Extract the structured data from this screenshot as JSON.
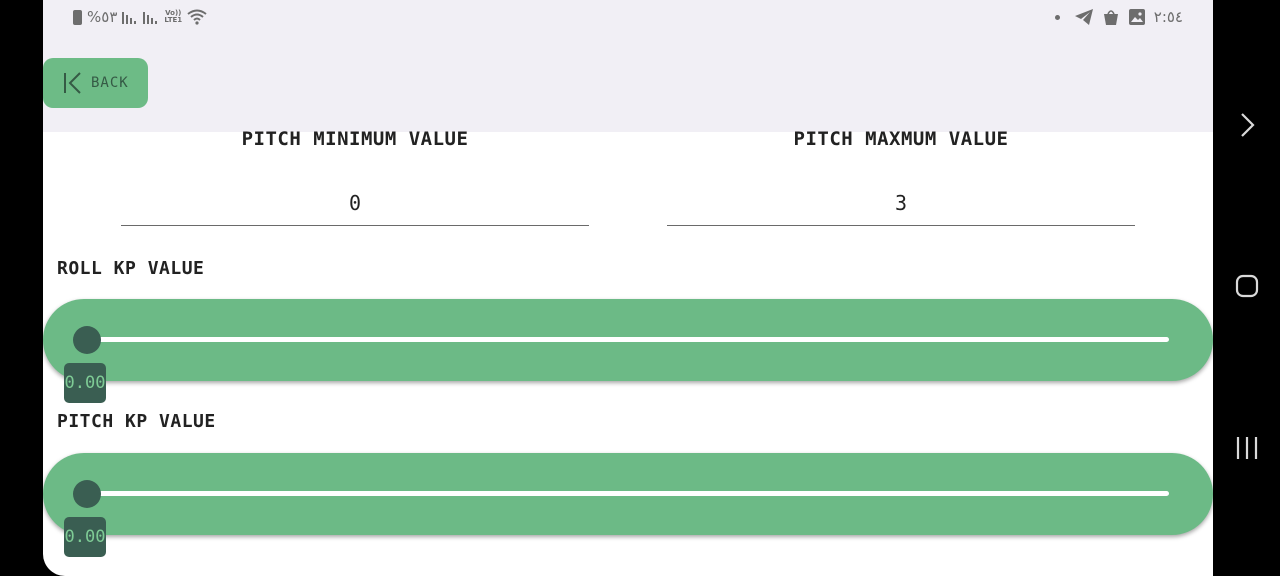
{
  "status_bar": {
    "battery": "%٥٣",
    "network_top": "Vo))",
    "network_bottom": "LTE1",
    "time": "٢:٥٤"
  },
  "back_button": {
    "label": "BACK"
  },
  "pitch_min": {
    "label": "PITCH MINIMUM VALUE",
    "value": "0"
  },
  "pitch_max": {
    "label": "PITCH MAXMUM VALUE",
    "value": "3"
  },
  "roll_kp": {
    "label": "ROLL KP VALUE",
    "value": "0.00",
    "fraction": 0.0
  },
  "pitch_kp": {
    "label": "PITCH KP VALUE",
    "value": "0.00",
    "fraction": 0.0
  },
  "colors": {
    "accent": "#6cba86",
    "thumb": "#3a5e52",
    "header_bg": "#f1eff5"
  },
  "icons": [
    "battery-icon",
    "signal-icon",
    "wifi-icon",
    "telegram-icon",
    "shopping-bag-icon",
    "gallery-icon",
    "back-chevron-icon",
    "nav-forward-icon",
    "nav-home-icon",
    "nav-recents-icon"
  ]
}
